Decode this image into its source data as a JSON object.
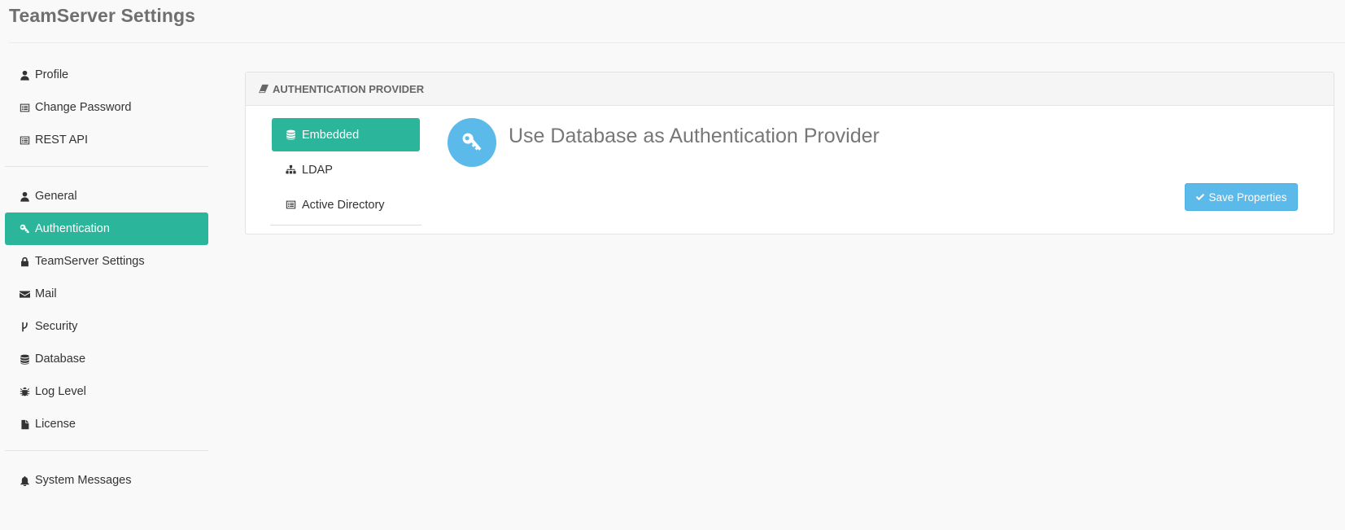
{
  "page": {
    "title": "TeamServer Settings"
  },
  "colors": {
    "accent": "#2bb69b",
    "info": "#5bbaea",
    "background": "#f9f9f9"
  },
  "sidebar": {
    "groups": [
      [
        {
          "label": "Profile",
          "icon": "user-icon"
        },
        {
          "label": "Change Password",
          "icon": "list-alt-icon"
        },
        {
          "label": "REST API",
          "icon": "list-alt-icon"
        }
      ],
      [
        {
          "label": "General",
          "icon": "user-icon"
        },
        {
          "label": "Authentication",
          "icon": "key-icon",
          "active": true
        },
        {
          "label": "TeamServer Settings",
          "icon": "lock-icon"
        },
        {
          "label": "Mail",
          "icon": "envelope-icon"
        },
        {
          "label": "Security",
          "icon": "code-fork-icon"
        },
        {
          "label": "Database",
          "icon": "database-icon"
        },
        {
          "label": "Log Level",
          "icon": "bug-icon"
        },
        {
          "label": "License",
          "icon": "file-icon"
        }
      ],
      [
        {
          "label": "System Messages",
          "icon": "bell-icon"
        }
      ]
    ]
  },
  "auth_panel": {
    "header": "AUTHENTICATION PROVIDER",
    "header_icon": "eraser-icon",
    "providers": [
      {
        "label": "Embedded",
        "icon": "database-icon",
        "active": true
      },
      {
        "label": "LDAP",
        "icon": "sitemap-icon"
      },
      {
        "label": "Active Directory",
        "icon": "list-alt-icon"
      }
    ],
    "heading": "Use Database as Authentication Provider",
    "heading_icon": "key-icon",
    "save_label": "Save Properties",
    "save_icon": "check-icon"
  }
}
